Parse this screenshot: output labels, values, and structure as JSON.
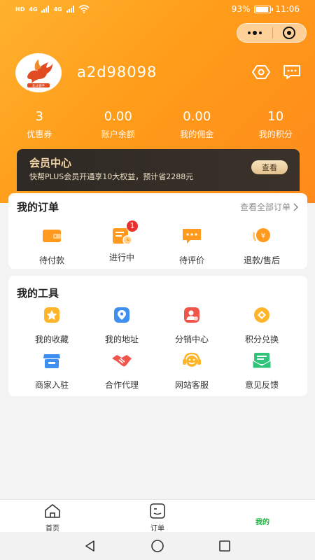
{
  "status_bar": {
    "left_badges": [
      "HD",
      "4G",
      "4G"
    ],
    "battery": "93%",
    "time": "11:06"
  },
  "profile": {
    "username": "a2d98098",
    "avatar_caption": "北斗骑手"
  },
  "stats": [
    {
      "value": "3",
      "label": "优惠券"
    },
    {
      "value": "0.00",
      "label": "账户余额"
    },
    {
      "value": "0.00",
      "label": "我的佣金"
    },
    {
      "value": "10",
      "label": "我的积分"
    }
  ],
  "member": {
    "title": "会员中心",
    "subtitle": "快帮PLUS会员开通享10大权益，预计省2288元",
    "button": "查看"
  },
  "orders": {
    "title": "我的订单",
    "see_all": "查看全部订单",
    "items": [
      {
        "label": "待付款",
        "icon": "wallet-icon",
        "badge": ""
      },
      {
        "label": "进行中",
        "icon": "order-progress-icon",
        "badge": "1"
      },
      {
        "label": "待评价",
        "icon": "comment-icon",
        "badge": ""
      },
      {
        "label": "退款/售后",
        "icon": "refund-icon",
        "badge": ""
      }
    ]
  },
  "tools": {
    "title": "我的工具",
    "items": [
      {
        "label": "我的收藏",
        "icon": "star-icon"
      },
      {
        "label": "我的地址",
        "icon": "location-icon"
      },
      {
        "label": "分销中心",
        "icon": "distribution-icon"
      },
      {
        "label": "积分兑换",
        "icon": "points-exchange-icon"
      },
      {
        "label": "商家入驻",
        "icon": "store-icon"
      },
      {
        "label": "合作代理",
        "icon": "handshake-icon"
      },
      {
        "label": "网站客服",
        "icon": "customer-service-icon"
      },
      {
        "label": "意见反馈",
        "icon": "feedback-icon"
      }
    ]
  },
  "tabbar": [
    {
      "label": "首页",
      "icon": "home-icon"
    },
    {
      "label": "订单",
      "icon": "order-icon"
    },
    {
      "label": "我的",
      "icon": "",
      "active": true
    }
  ],
  "colors": {
    "header_orange": "#ff9c1a",
    "active_green": "#17b538",
    "badge_red": "#e8302c",
    "member_gold": "#f4d8a8"
  }
}
